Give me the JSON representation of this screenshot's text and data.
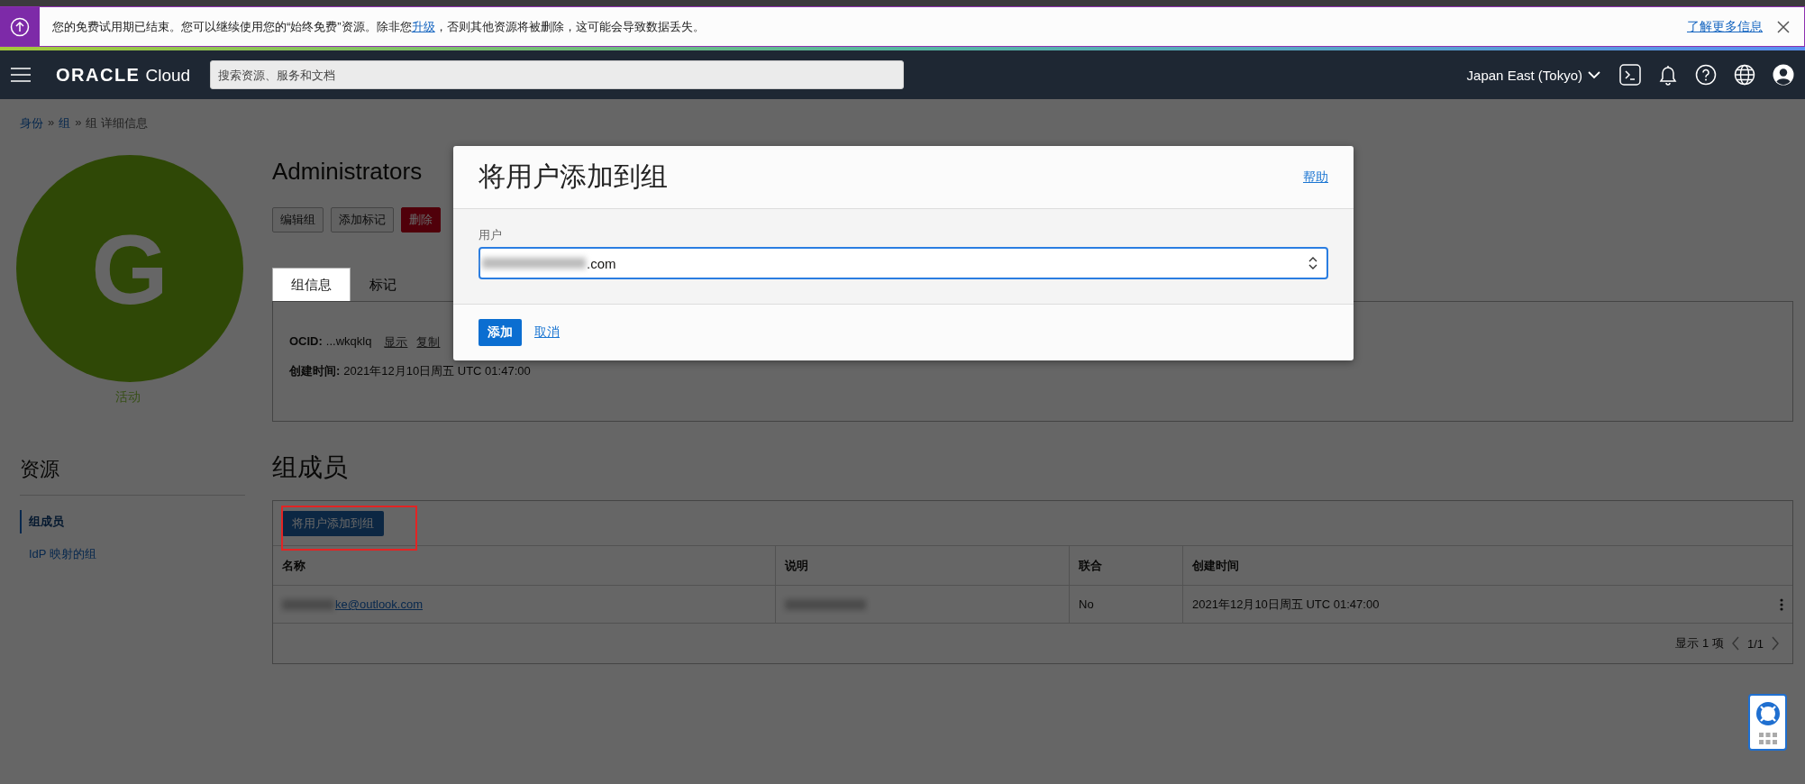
{
  "banner": {
    "message_before": "您的免费试用期已结束。您可以继续使用您的“始终免费”资源。除非您",
    "link": "升级",
    "message_after": "，否则其他资源将被删除，这可能会导致数据丢失。",
    "learn_more": "了解更多信息"
  },
  "nav": {
    "logo_brand": "ORACLE",
    "logo_product": "Cloud",
    "search_placeholder": "搜索资源、服务和文档",
    "region": "Japan East (Tokyo)"
  },
  "breadcrumb": {
    "separator": "»",
    "items": [
      {
        "label": "身份",
        "link": true
      },
      {
        "label": "组",
        "link": true
      },
      {
        "label": "组 详细信息",
        "link": false
      }
    ]
  },
  "avatar": {
    "letter": "G",
    "status": "活动"
  },
  "resources": {
    "title": "资源",
    "items": [
      {
        "label": "组成员",
        "selected": true
      },
      {
        "label": "IdP 映射的组",
        "selected": false
      }
    ]
  },
  "group": {
    "title": "Administrators",
    "actions": [
      {
        "label": "编辑组",
        "kind": "default"
      },
      {
        "label": "添加标记",
        "kind": "default"
      },
      {
        "label": "删除",
        "kind": "danger"
      }
    ]
  },
  "tabs": [
    {
      "label": "组信息",
      "selected": true
    },
    {
      "label": "标记",
      "selected": false
    }
  ],
  "info": {
    "ocid_label": "OCID:",
    "ocid_value": "...wkqklq",
    "ocid_links": [
      "显示",
      "复制"
    ],
    "created_label": "创建时间:",
    "created_value": "2021年12月10日周五 UTC 01:47:00"
  },
  "members": {
    "title": "组成员",
    "add_button": "将用户添加到组",
    "highlighted": true,
    "columns": [
      "名称",
      "说明",
      "联合",
      "创建时间"
    ],
    "rows": [
      {
        "name": "ke@outlook.com",
        "name_redacted": true,
        "description_redacted": true,
        "federated": "No",
        "created": "2021年12月10日周五 UTC 01:47:00"
      }
    ],
    "footer": {
      "count": "显示 1 项",
      "page": "1/1"
    }
  },
  "modal": {
    "title": "将用户添加到组",
    "help": "帮助",
    "field_label": "用户",
    "field_value": ".com",
    "field_redacted": true,
    "primary": "添加",
    "cancel": "取消"
  }
}
